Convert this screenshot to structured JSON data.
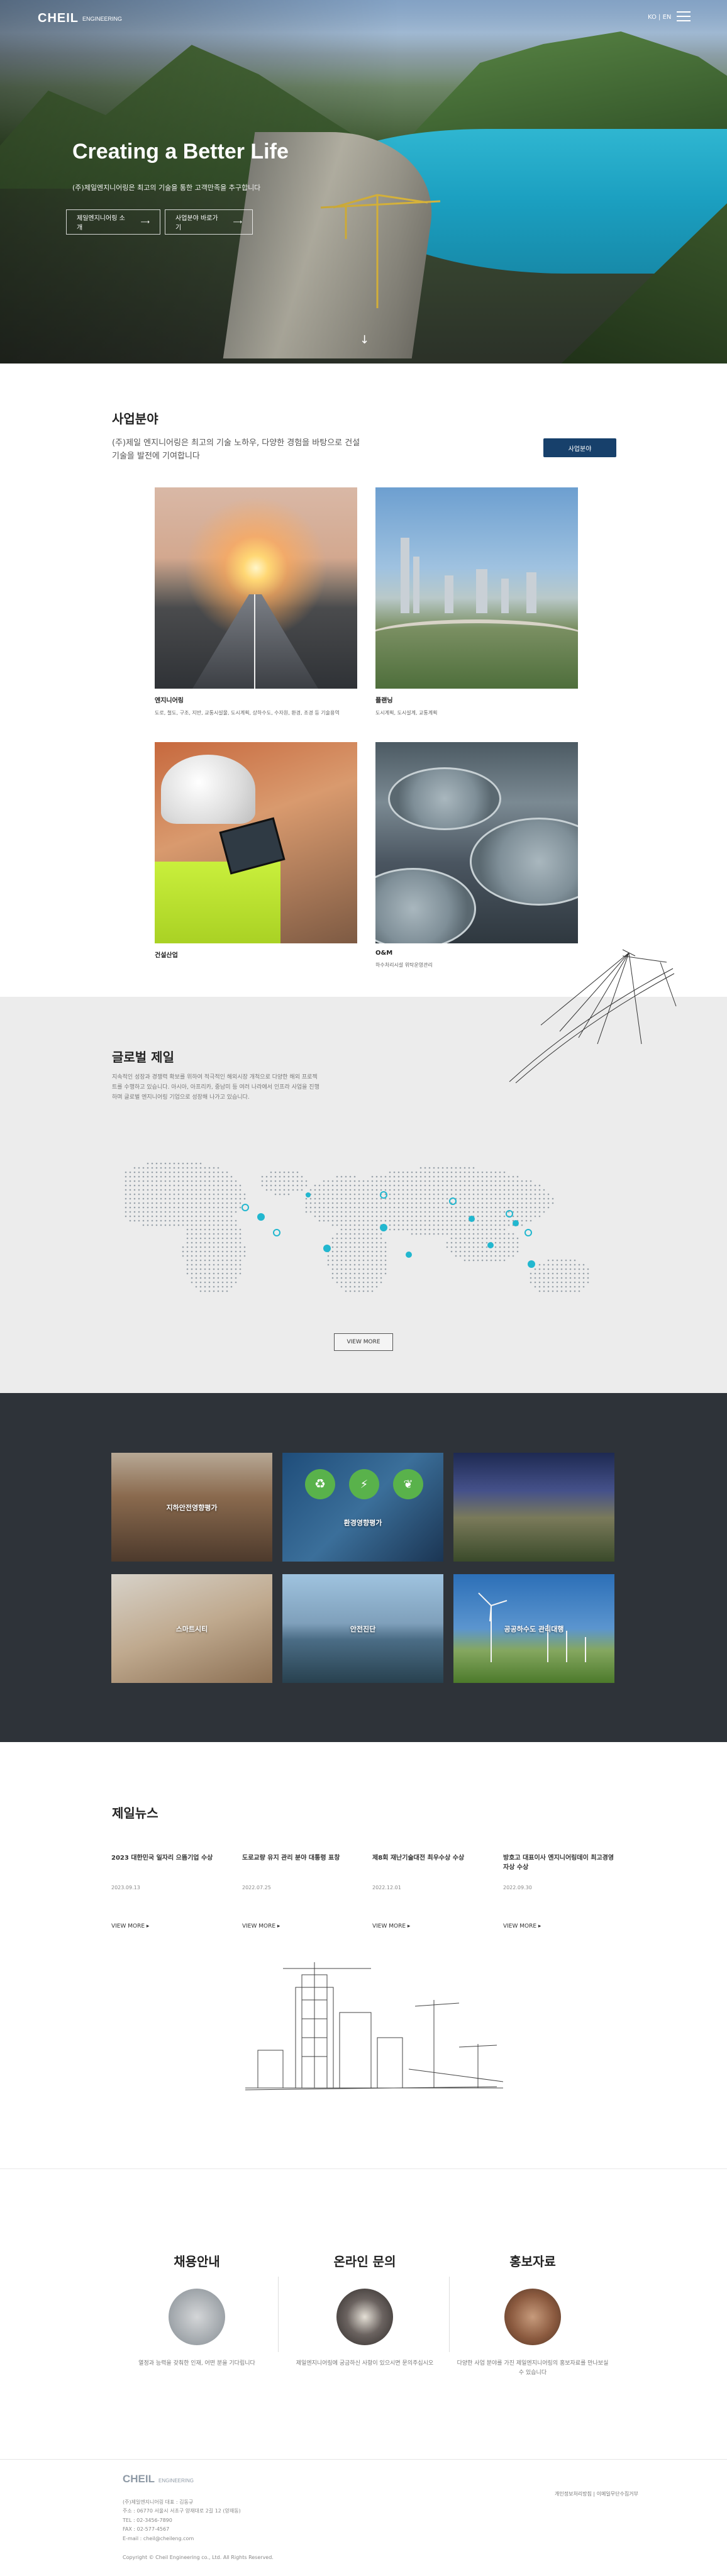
{
  "header": {
    "logo": "CHEIL",
    "logo_sub": "ENGINEERING",
    "lang": "KO | EN"
  },
  "hero": {
    "title": "Creating a Better Life",
    "subtitle": "(주)제일엔지니어링은 최고의 기술을 통한 고객만족을 추구합니다",
    "button1": "제일엔지니어링 소개",
    "button2": "사업분야 바로가기"
  },
  "business": {
    "title": "사업분야",
    "description": "(주)제일 엔지니어링은 최고의 기술 노하우, 다양한 경험을 바탕으로 건설기술을 발전에 기여합니다",
    "button": "사업분야",
    "cards": [
      {
        "name": "엔지니어링",
        "text": "도로, 철도, 구조, 지반, 교통시설물, 도시계획, 상하수도, 수자원, 환경, 조경 등 기술용역"
      },
      {
        "name": "플랜닝",
        "text": "도시계획, 도시설계, 교통계획"
      },
      {
        "name": "건설산업",
        "text": ""
      },
      {
        "name": "O&M",
        "text": "하수처리시설 위탁운영관리"
      }
    ]
  },
  "global": {
    "title": "글로벌 제일",
    "description": "지속적인 성장과 경쟁력 확보를 위하여 적극적인 해외시장 개척으로 다양한 해외 프로젝트를 수행하고 있습니다. 아시아, 아프리카, 중남미 등 여러 나라에서 인프라 사업을 진행하며 글로벌 엔지니어링 기업으로 성장해 나가고 있습니다.",
    "button": "VIEW MORE"
  },
  "tiles": [
    {
      "label": "지하안전영향평가"
    },
    {
      "label": "환경영향평가"
    },
    {
      "label": ""
    },
    {
      "label": "스마트시티"
    },
    {
      "label": "안전진단"
    },
    {
      "label": "공공하수도 관리대행"
    }
  ],
  "news": {
    "title": "제일뉴스",
    "more": "VIEW MORE",
    "items": [
      {
        "head": "2023 대한민국 일자리 으뜸기업 수상",
        "date": "2023.09.13"
      },
      {
        "head": "도로교량 유지 관리 분야 대통령 표창",
        "date": "2022.07.25"
      },
      {
        "head": "제8회 재난기술대전 최우수상 수상",
        "date": "2022.12.01"
      },
      {
        "head": "방호고 대표이사 엔지니어링데이 최고경영자상 수상",
        "date": "2022.09.30"
      }
    ]
  },
  "contact": [
    {
      "title": "채용안내",
      "text": "열정과 능력을 갖춰한 인재, 어떤 분을 기다립니다"
    },
    {
      "title": "온라인 문의",
      "text": "제일엔지니어링에 궁금하신 사항이 있으시면 문의주십시오"
    },
    {
      "title": "홍보자료",
      "text": "다양한 사업 분야를 가진 제일엔지니어링의 홍보자료를 만나보실 수 있습니다"
    }
  ],
  "footer": {
    "logo": "CHEIL",
    "logo_sub": "ENGINEERING",
    "company": "(주)제일엔지니어링 대표 : 김동규",
    "address": "주소 : 06770 서울시 서초구 양재대로 2길 12 (양재동)",
    "tel": "TEL : 02-3456-7890",
    "fax": "FAX : 02-577-4567",
    "email": "E-mail : cheil@cheileng.com",
    "links": "개인정보처리방침  |  이메일무단수집거부",
    "copyright": "Copyright © Cheil Engineering co., Ltd. All Rights Reserved."
  }
}
